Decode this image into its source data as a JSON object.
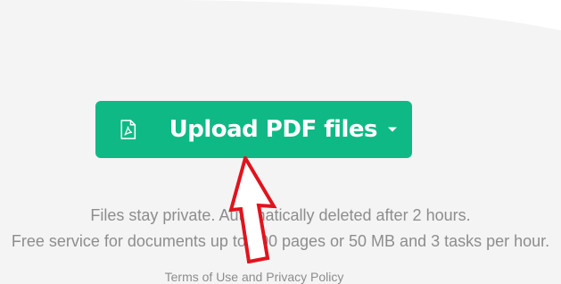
{
  "upload": {
    "label": "Upload PDF files",
    "icon": "pdf-file-icon",
    "dropdown_icon": "caret-down-icon",
    "color": "#0fb985"
  },
  "info": {
    "privacy_line": "Files stay private. Automatically deleted after 2 hours.",
    "limits_line": "Free service for documents up to 200 pages or 50 MB and 3 tasks per hour."
  },
  "footer": {
    "terms_label": "Terms of Use",
    "and_label": "and",
    "privacy_label": "Privacy Policy"
  },
  "annotation": {
    "arrow_color": "#e0141e"
  }
}
